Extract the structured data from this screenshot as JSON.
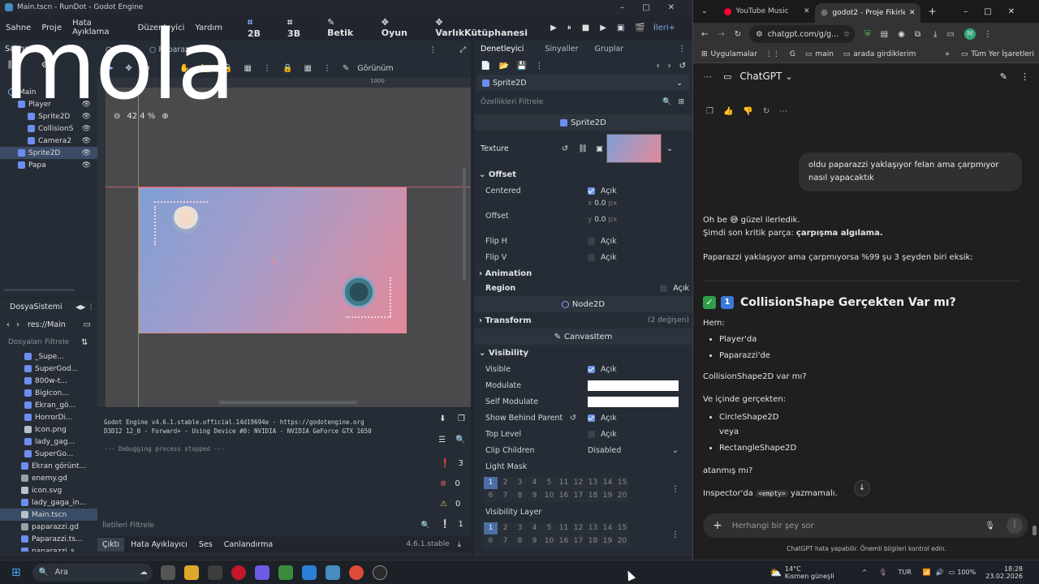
{
  "godot": {
    "window_title": "Main.tscn - RunDot - Godot Engine",
    "menu": [
      "Sahne",
      "Proje",
      "Hata Ayıklama",
      "Düzenleyici",
      "Yardım"
    ],
    "workspaces": [
      "2B",
      "3B",
      "Betik",
      "Oyun",
      "VarlıkKütüphanesi"
    ],
    "renderer": "İleri+",
    "scene_tabs": [
      "Main",
      "Paparazzi"
    ],
    "overlay_text": "mola",
    "scene_panel_title": "Sahne",
    "scene_tree": [
      {
        "name": "Main",
        "icon": "node2d-icon",
        "level": 0
      },
      {
        "name": "Player",
        "icon": "character-icon",
        "level": 1
      },
      {
        "name": "Sprite2D",
        "icon": "sprite-icon",
        "level": 2
      },
      {
        "name": "CollisionS",
        "icon": "collision-icon",
        "level": 2
      },
      {
        "name": "Camera2",
        "icon": "camera-icon",
        "level": 2
      },
      {
        "name": "Sprite2D",
        "icon": "sprite-icon",
        "level": 1,
        "selected": true
      },
      {
        "name": "Papa",
        "icon": "node-icon",
        "level": 1
      }
    ],
    "filesystem": {
      "title": "DosyaSistemi",
      "path": "res://Main",
      "filter_placeholder": "Dosyaları Filtrele",
      "items": [
        "_Supe...",
        "SuperGod...",
        "800w-t...",
        "BigIcon...",
        "Ekran_gö...",
        "HorrorDi...",
        "Icon.png",
        "lady_gag...",
        "SuperGo...",
        "Ekran görünt...",
        "enemy.gd",
        "icon.svg",
        "lady_gaga_in...",
        "Main.tscn",
        "paparazzi.gd",
        "Paparazzi.ts...",
        "paparazzi_s..."
      ]
    },
    "viewport": {
      "zoom": "42.4 %",
      "view_label": "Görünüm",
      "ruler_mark": "1000",
      "selected_node": "Sprite2D"
    },
    "output": {
      "lines": [
        "Godot Engine v4.6.1.stable.official.14d19694e - https://godotengine.org",
        "D3D12 12_0 - Forward+ - Using Device #0: NVIDIA - NVIDIA GeForce GTX 1650",
        "",
        "--- Debugging process stopped ---"
      ],
      "filter_placeholder": "İletileri Filtrele",
      "counts": {
        "log": "3",
        "errors": "0",
        "warnings": "0",
        "info": "1"
      },
      "bottom_tabs": [
        "Çıktı",
        "Hata Ayıklayıcı",
        "Ses",
        "Canlandırma"
      ],
      "version": "4.6.1.stable"
    },
    "inspector": {
      "tabs": [
        "Denetleyici",
        "Sinyaller",
        "Gruplar"
      ],
      "node_name": "Sprite2D",
      "filter_placeholder": "Özellikleri Filtrele",
      "class_header": "Sprite2D",
      "texture_label": "Texture",
      "offset_section": "Offset",
      "centered_label": "Centered",
      "on_text": "Açık",
      "offset_label": "Offset",
      "offset_x": "0.0",
      "offset_y": "0.0",
      "unit": "px",
      "fliph_label": "Flip H",
      "flipv_label": "Flip V",
      "animation_section": "Animation",
      "region_label": "Region",
      "node2d_header": "Node2D",
      "transform_section": "Transform",
      "transform_changes": "(2 değişen)",
      "canvasitem_header": "CanvasItem",
      "visibility_section": "Visibility",
      "visible_label": "Visible",
      "modulate_label": "Modulate",
      "self_modulate_label": "Self Modulate",
      "show_behind_label": "Show Behind Parent",
      "top_level_label": "Top Level",
      "clip_children_label": "Clip Children",
      "clip_children_value": "Disabled",
      "light_mask_label": "Light Mask",
      "visibility_layer_label": "Visibility Layer",
      "layers_row1": [
        "1",
        "2",
        "3",
        "4",
        "5",
        "11",
        "12",
        "13",
        "14",
        "15"
      ],
      "layers_row2": [
        "6",
        "7",
        "8",
        "9",
        "10",
        "16",
        "17",
        "18",
        "19",
        "20"
      ]
    }
  },
  "chrome": {
    "tabs": [
      {
        "title": "YouTube Music",
        "active": false
      },
      {
        "title": "godot2 - Proje Fikirleri",
        "active": true
      }
    ],
    "url": "chatgpt.com/g/g...",
    "bookmarks": [
      "Uygulamalar",
      "main",
      "arada girdiklerim"
    ],
    "bookmarks_right": "Tüm Yer İşaretleri",
    "app_title": "ChatGPT",
    "user_message": "oldu paparazzi yaklaşıyor felan  ama çarpmıyor nasıl yapacaktık",
    "assistant": {
      "p1": "Oh be 😅 güzel ilerledik.",
      "p2_prefix": "Şimdi son kritik parça: ",
      "p2_bold": "çarpışma algılama.",
      "p3": "Paparazzi yaklaşıyor ama çarpmıyorsa %99 şu 3 şeyden biri eksik:",
      "heading": "CollisionShape Gerçekten Var mı?",
      "hem": "Hem:",
      "list1": [
        "Player'da",
        "Paparazzi'de"
      ],
      "q1": "CollisionShape2D var mı?",
      "q2": "Ve içinde gerçekten:",
      "list2a": "CircleShape2D",
      "list2a_sub": "veya",
      "list2b": "RectangleShape2D",
      "q3": "atanmış mı?",
      "q4_prefix": "Inspector'da ",
      "q4_code": "<empty>",
      "q4_suffix": " yazmamalı."
    },
    "input_placeholder": "Herhangi bir şey sor",
    "disclaimer": "ChatGPT hata yapabilir. Önemli bilgileri kontrol edin."
  },
  "taskbar": {
    "search": "Ara",
    "weather_temp": "14°C",
    "weather_desc": "Kısmen güneşli",
    "lang": "TUR",
    "battery": "100%",
    "time": "18:28",
    "date": "23.02.2026"
  },
  "colors": {
    "accent": "#8ab4f8",
    "godot_bg": "#21262e",
    "sprite_gradient_start": "#7f9fd6",
    "sprite_gradient_end": "#e38a9a",
    "chrome_bg": "#1f1f1f"
  }
}
